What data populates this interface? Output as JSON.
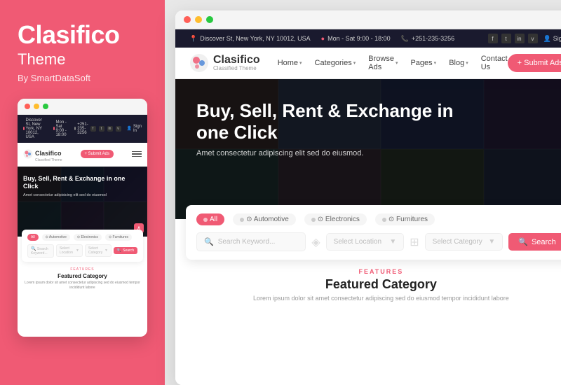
{
  "left": {
    "brand": {
      "name": "Clasifico",
      "subtitle": "Theme",
      "by": "By SmartDataSoft"
    },
    "mini_browser": {
      "topbar": {
        "address": "Discover St, New York, NY 10012, USA",
        "hours": "Mon - Sat 9:00 - 18:00",
        "phone": "+251-235-3256",
        "signin": "Sign In"
      },
      "nav": {
        "logo_name": "Clasifico",
        "logo_sub": "Classified Theme",
        "submit_btn": "+ Submit Ads"
      },
      "hero": {
        "title": "Buy, Sell, Rent & Exchange in one Click",
        "sub": "Amet consectetur adipisicing elit sed do eiusmod"
      },
      "search": {
        "tabs": [
          "All",
          "Automotive",
          "Electronics",
          "Furnitures"
        ],
        "active_tab": "All",
        "placeholder": "Search Keyword...",
        "location": "Select Location",
        "category": "Select Category",
        "search_btn": "Search"
      },
      "features": {
        "label": "FEATURES",
        "title": "Featured Category",
        "text": "Lorem ipsum dolor sit amet consectetur adipiscing sed do eiusmod tempor incididunt labore"
      }
    }
  },
  "right": {
    "browser": {
      "topbar": {
        "address": "Discover St, New York, NY 10012, USA",
        "hours": "Mon - Sat 9:00 - 18:00",
        "phone": "+251-235-3256",
        "social": [
          "f",
          "t",
          "in",
          "v"
        ],
        "signin": "Sign In"
      },
      "nav": {
        "logo_name": "Clasifico",
        "logo_sub": "Classified Theme",
        "links": [
          {
            "label": "Home",
            "has_dropdown": true
          },
          {
            "label": "Categories",
            "has_dropdown": true
          },
          {
            "label": "Browse Ads",
            "has_dropdown": true
          },
          {
            "label": "Pages",
            "has_dropdown": true
          },
          {
            "label": "Blog",
            "has_dropdown": true
          },
          {
            "label": "Contact Us",
            "has_dropdown": false
          }
        ],
        "submit_btn": "+ Submit Ads"
      },
      "hero": {
        "title": "Buy, Sell, Rent & Exchange in one Click",
        "sub": "Amet consectetur adipiscing elit sed do eiusmod."
      },
      "search": {
        "tabs": [
          {
            "label": "All",
            "active": true
          },
          {
            "label": "Automotive",
            "active": false
          },
          {
            "label": "Electronics",
            "active": false
          },
          {
            "label": "Furnitures",
            "active": false
          }
        ],
        "search_placeholder": "Search Keyword...",
        "location_placeholder": "Select Location",
        "category_placeholder": "Select Category",
        "search_btn": "Search"
      },
      "features": {
        "label": "FEATURES",
        "title": "Featured Category",
        "text": "Lorem ipsum dolor sit amet consectetur adipiscing sed do eiusmod tempor incididunt labore"
      }
    }
  },
  "colors": {
    "accent": "#f05a74",
    "dark_nav": "#1a1a2e",
    "text_dark": "#222222",
    "text_muted": "#999999"
  }
}
